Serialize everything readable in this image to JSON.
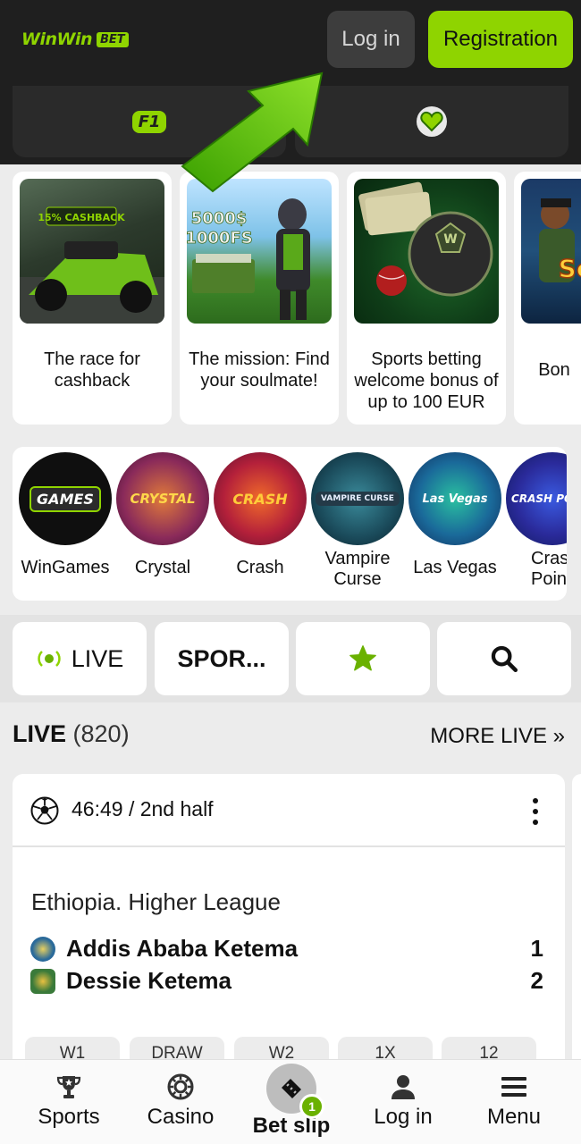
{
  "header": {
    "logo_primary": "WinWin",
    "logo_badge": "BET",
    "login_label": "Log in",
    "registration_label": "Registration"
  },
  "subnav": {
    "items": [
      {
        "icon": "f1-icon",
        "label": "F1"
      },
      {
        "icon": "heart-icon",
        "label": ""
      }
    ]
  },
  "promos": [
    {
      "title": "The race for cashback",
      "image_text": "15% CASHBACK"
    },
    {
      "title": "The mission: Find your soulmate!",
      "image_text": "5000$ 1000FS"
    },
    {
      "title": "Sports betting welcome bonus of up to 100 EUR",
      "image_text": ""
    },
    {
      "title": "Bon",
      "image_text": "Sc"
    }
  ],
  "games": [
    {
      "label": "WinGames",
      "art": "GAMES"
    },
    {
      "label": "Crystal",
      "art": "CRYSTAL"
    },
    {
      "label": "Crash",
      "art": "CRASH"
    },
    {
      "label": "Vampire Curse",
      "art": "VAMPIRE CURSE"
    },
    {
      "label": "Las Vegas",
      "art": "Las Vegas"
    },
    {
      "label": "Crash Poin",
      "art": "CRASH POINT"
    }
  ],
  "filters": {
    "live_label": "LIVE",
    "sports_label": "SPOR...",
    "favorites_icon": "star-icon",
    "search_icon": "search-icon"
  },
  "live_section": {
    "title": "LIVE",
    "count": "(820)",
    "more_label": "MORE LIVE »"
  },
  "match": {
    "time": "46:49 / 2nd half",
    "league": "Ethiopia. Higher League",
    "team1": "Addis Ababa Ketema",
    "team2": "Dessie Ketema",
    "score1": "1",
    "score2": "2",
    "odds_headers": [
      "W1",
      "DRAW",
      "W2",
      "1X",
      "12"
    ]
  },
  "bottom_nav": {
    "sports": "Sports",
    "casino": "Casino",
    "bet_slip": "Bet slip",
    "bet_slip_count": "1",
    "login": "Log in",
    "menu": "Menu"
  },
  "colors": {
    "accent": "#8fd400",
    "header_bg": "#1f1f1f",
    "page_bg": "#ececec"
  }
}
